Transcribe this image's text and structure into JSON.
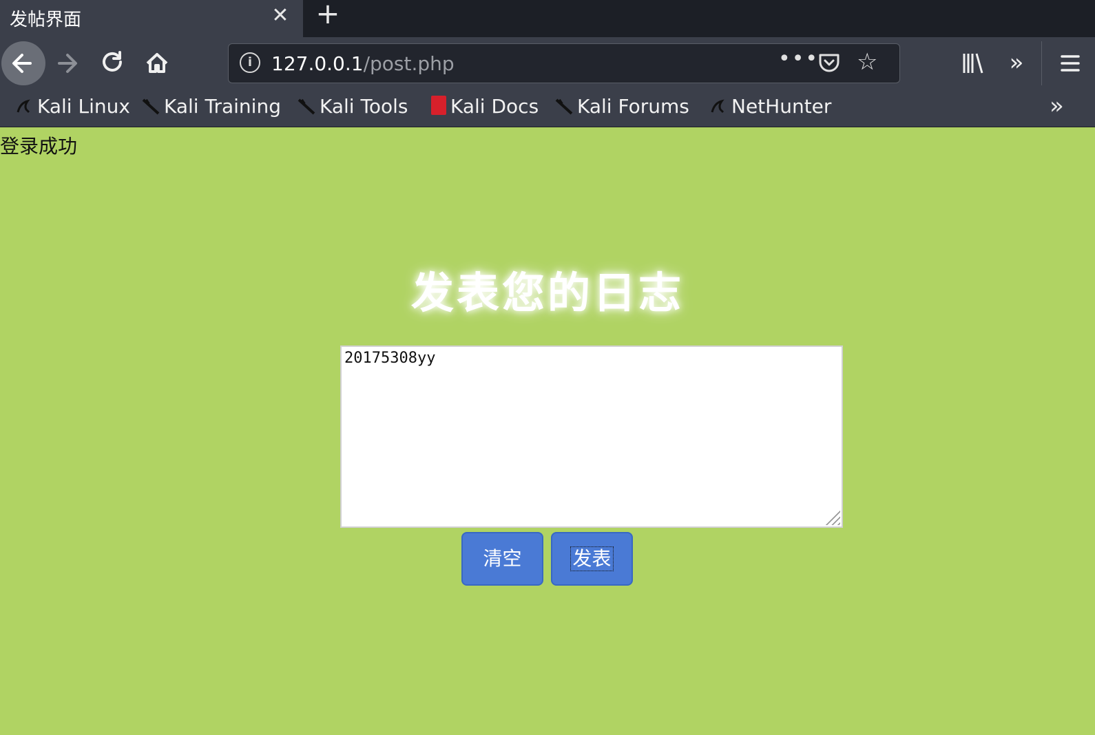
{
  "browser": {
    "tab_title": "发帖界面",
    "tab_close_glyph": "✕",
    "new_tab_glyph": "+",
    "url_host": "127.0.0.1",
    "url_path": "/post.php",
    "url_more_glyph": "•••",
    "bookmarks": [
      "Kali Linux",
      "Kali Training",
      "Kali Tools",
      "Kali Docs",
      "Kali Forums",
      "NetHunter"
    ],
    "overflow_glyph": "»"
  },
  "page": {
    "login_status": "登录成功",
    "heading": "发表您的日志",
    "textarea_value": "20175308yy",
    "clear_button": "清空",
    "post_button": "发表"
  },
  "colors": {
    "page_background": "#b0d363",
    "button_background": "#4a7ad5",
    "chrome_background": "#3b3f4a"
  }
}
